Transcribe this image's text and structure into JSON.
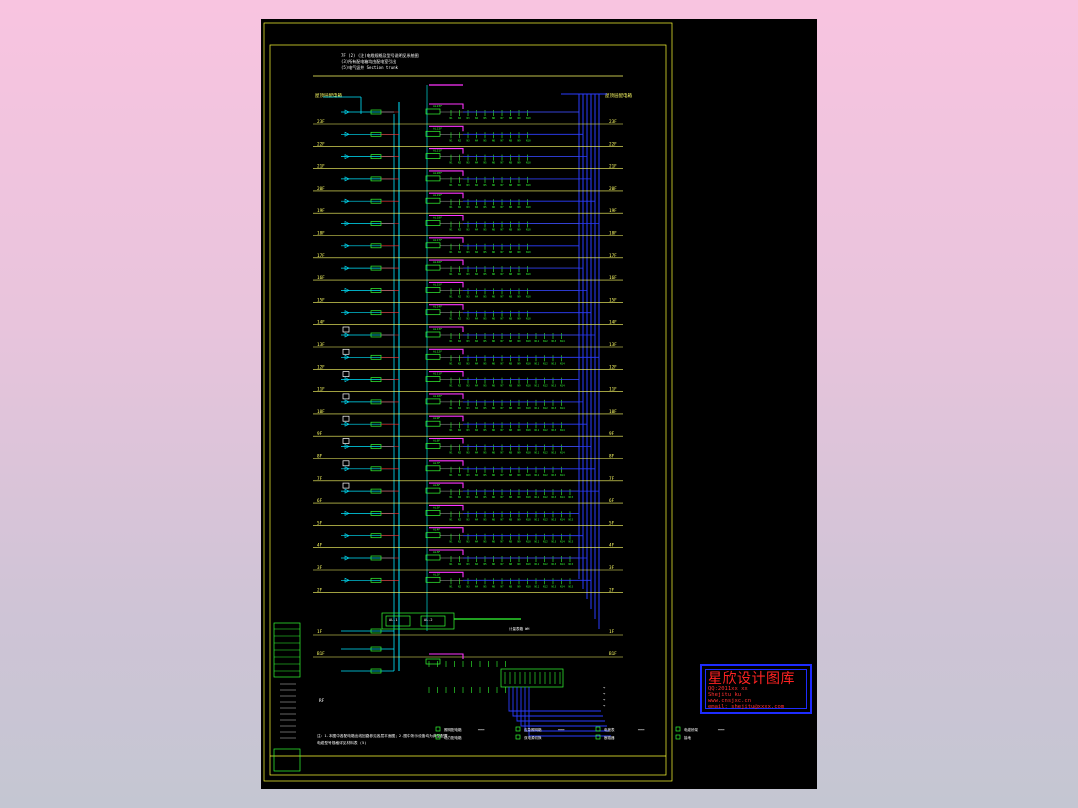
{
  "drawing": {
    "header_notes": [
      "7F (2) (注)电缆规格及型号说明见系统图",
      "  (3)所有配电箱均由配电室引出",
      "  (5)电气竖井 Section trunk"
    ],
    "riser_top_left_label": "屋顶层配电箱",
    "riser_top_right_label": "屋顶层配电箱",
    "floors": [
      "23F",
      "22F",
      "21F",
      "20F",
      "19F",
      "18F",
      "17F",
      "16F",
      "15F",
      "14F",
      "13F",
      "12F",
      "11F",
      "10F",
      "9F",
      "8F",
      "7F",
      "6F",
      "5F",
      "4F",
      "3F",
      "2F"
    ],
    "ground_floor": "1F",
    "basement_floor": "B1F",
    "roof_floor": "RF",
    "panel_labels": [
      "AL-1",
      "AL-2"
    ],
    "bottom_note": "注：1.本图中各配电箱出线回路参见各层平面图；2.图中所示设备均为典型配置",
    "bottom_note_2": "  电缆型号规格详见材料表  (5)",
    "legend": [
      [
        "照明配电箱",
        "动力配电箱"
      ],
      [
        "应急照明箱",
        "双电源切换"
      ],
      [
        "电度表",
        "断路器"
      ],
      [
        "电缆桥架",
        "接地"
      ]
    ],
    "meter_row_label": "计量表箱 WH",
    "colors": {
      "frame": "#ffff33",
      "bus": "#00e5ff",
      "feeder": "#ff33ff",
      "circuit": "#33ff33",
      "riser": "#2a3cff",
      "floor_line": "#ffff66",
      "red": "#ff3030"
    }
  },
  "stamp": {
    "title": "星欣设计图库",
    "line1": "QQ:2011xx xx",
    "line2": "Shejitu ku",
    "line3": "www.cnsjxc.cn",
    "line4": "email: shejitu@xxxx.com"
  }
}
